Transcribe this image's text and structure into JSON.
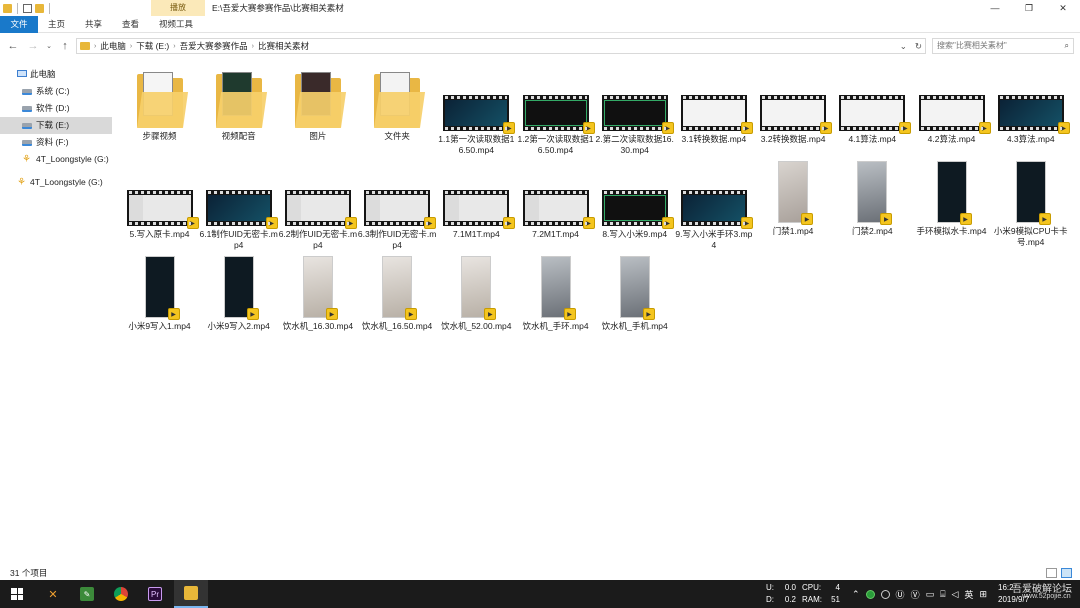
{
  "window": {
    "title_path": "E:\\吾爱大赛参赛作品\\比赛相关素材",
    "context_tab": "播放",
    "controls": [
      "—",
      "❐",
      "✕"
    ]
  },
  "ribbon": {
    "tabs": [
      "文件",
      "主页",
      "共享",
      "查看",
      "视频工具"
    ]
  },
  "address": {
    "crumbs": [
      "此电脑",
      "下载 (E:)",
      "吾爱大赛参赛作品",
      "比赛相关素材"
    ]
  },
  "search": {
    "placeholder": "搜索\"比赛相关素材\""
  },
  "nav": {
    "items": [
      {
        "label": "此电脑",
        "icon": "pc-icon",
        "level": 1
      },
      {
        "label": "系统 (C:)",
        "icon": "drive-icon",
        "level": 2
      },
      {
        "label": "软件 (D:)",
        "icon": "drive-icon",
        "level": 2
      },
      {
        "label": "下载 (E:)",
        "icon": "drive-icon",
        "level": 2,
        "selected": true
      },
      {
        "label": "资料 (F:)",
        "icon": "drive-icon",
        "level": 2
      },
      {
        "label": "4T_Loongstyle (G:)",
        "icon": "network-drive-icon",
        "level": 2
      },
      {
        "label": "4T_Loongstyle (G:)",
        "icon": "network-drive-icon",
        "level": 1
      }
    ]
  },
  "files": [
    {
      "name": "步骤视频",
      "type": "folder"
    },
    {
      "name": "视频配音",
      "type": "folder"
    },
    {
      "name": "图片",
      "type": "folder"
    },
    {
      "name": "文件夹",
      "type": "folder"
    },
    {
      "name": "1.1第一次读取数据16.50.mp4",
      "type": "video",
      "thumb": "dark"
    },
    {
      "name": "1.2第一次读取数据16.50.mp4",
      "type": "video",
      "thumb": "term"
    },
    {
      "name": "2.第二次读取数据16.30.mp4",
      "type": "video",
      "thumb": "term"
    },
    {
      "name": "3.1转换数据.mp4",
      "type": "video",
      "thumb": "light"
    },
    {
      "name": "3.2转换数据.mp4",
      "type": "video",
      "thumb": "light"
    },
    {
      "name": "4.1算法.mp4",
      "type": "video",
      "thumb": "light"
    },
    {
      "name": "4.2算法.mp4",
      "type": "video",
      "thumb": "light"
    },
    {
      "name": "4.3算法.mp4",
      "type": "video",
      "thumb": "dark"
    },
    {
      "name": "5.写入原卡.mp4",
      "type": "video",
      "thumb": "app"
    },
    {
      "name": "6.1制作UID无密卡.mp4",
      "type": "video",
      "thumb": "dark"
    },
    {
      "name": "6.2制作UID无密卡.mp4",
      "type": "video",
      "thumb": "app"
    },
    {
      "name": "6.3制作UID无密卡.mp4",
      "type": "video",
      "thumb": "app"
    },
    {
      "name": "7.1M1T.mp4",
      "type": "video",
      "thumb": "app"
    },
    {
      "name": "7.2M1T.mp4",
      "type": "video",
      "thumb": "app"
    },
    {
      "name": "8.写入小米9.mp4",
      "type": "video",
      "thumb": "term"
    },
    {
      "name": "9.写入小米手环3.mp4",
      "type": "video",
      "thumb": "dark"
    },
    {
      "name": "门禁1.mp4",
      "type": "portrait",
      "thumb": "photo1"
    },
    {
      "name": "门禁2.mp4",
      "type": "portrait",
      "thumb": "photo2"
    },
    {
      "name": "手环模拟水卡.mp4",
      "type": "portrait",
      "thumb": "phone"
    },
    {
      "name": "小米9模拟CPU卡卡号.mp4",
      "type": "portrait",
      "thumb": "phone"
    },
    {
      "name": "小米9写入1.mp4",
      "type": "portrait",
      "thumb": "phone"
    },
    {
      "name": "小米9写入2.mp4",
      "type": "portrait",
      "thumb": "phone"
    },
    {
      "name": "饮水机_16.30.mp4",
      "type": "portrait",
      "thumb": "photo3"
    },
    {
      "name": "饮水机_16.50.mp4",
      "type": "portrait",
      "thumb": "photo3"
    },
    {
      "name": "饮水机_52.00.mp4",
      "type": "portrait",
      "thumb": "photo3"
    },
    {
      "name": "饮水机_手环.mp4",
      "type": "portrait",
      "thumb": "photo2"
    },
    {
      "name": "饮水机_手机.mp4",
      "type": "portrait",
      "thumb": "photo2"
    }
  ],
  "status": {
    "count": "31 个项目"
  },
  "taskbar": {
    "perf": {
      "u_label": "U:",
      "u_val": "0.0",
      "cpu_label": "CPU:",
      "cpu_val": "4",
      "d_label": "D:",
      "d_val": "0.2",
      "ram_label": "RAM:",
      "ram_val": "51"
    },
    "ime": "英",
    "clock_time": "16:2",
    "clock_date": "2019/9/7"
  },
  "watermark": {
    "line1": "吾爱破解论坛",
    "line2": "www.52pojie.cn"
  }
}
